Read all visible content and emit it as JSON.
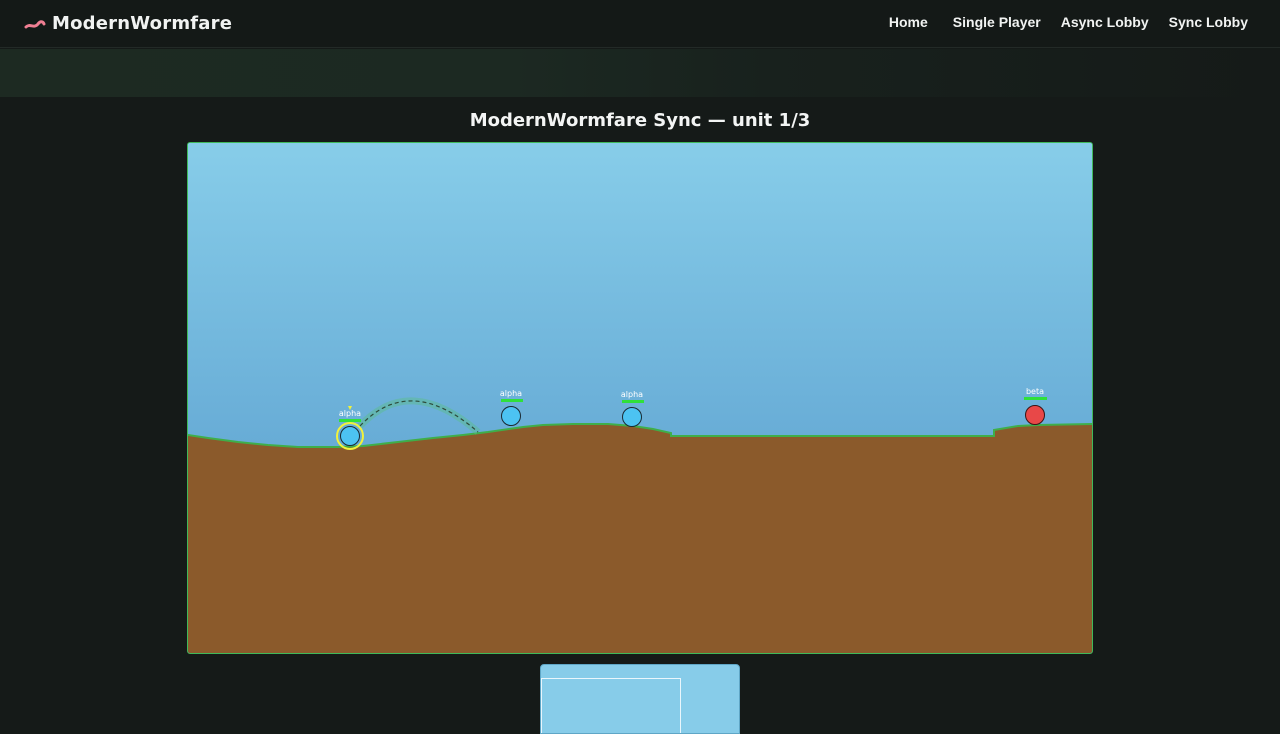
{
  "nav": {
    "brand": "ModernWormfare",
    "links": [
      "Home",
      "Single Player",
      "Async Lobby",
      "Sync Lobby"
    ]
  },
  "game": {
    "title": "ModernWormfare Sync — unit 1/3",
    "worms": [
      {
        "label": "alpha",
        "team": "alpha",
        "active": true
      },
      {
        "label": "alpha",
        "team": "alpha",
        "active": false
      },
      {
        "label": "alpha",
        "team": "alpha",
        "active": false
      },
      {
        "label": "beta",
        "team": "beta",
        "active": false
      }
    ]
  },
  "colors": {
    "accent": "#3fb95a",
    "sky_top": "#87cde9",
    "sky_bottom": "#5fa3d1",
    "ground": "#8b5a2b",
    "grass": "#3fae4a",
    "team_alpha": "#4cc3f2",
    "team_beta": "#e84848",
    "active_ring": "#f2f23a",
    "health": "#2fe03a"
  }
}
